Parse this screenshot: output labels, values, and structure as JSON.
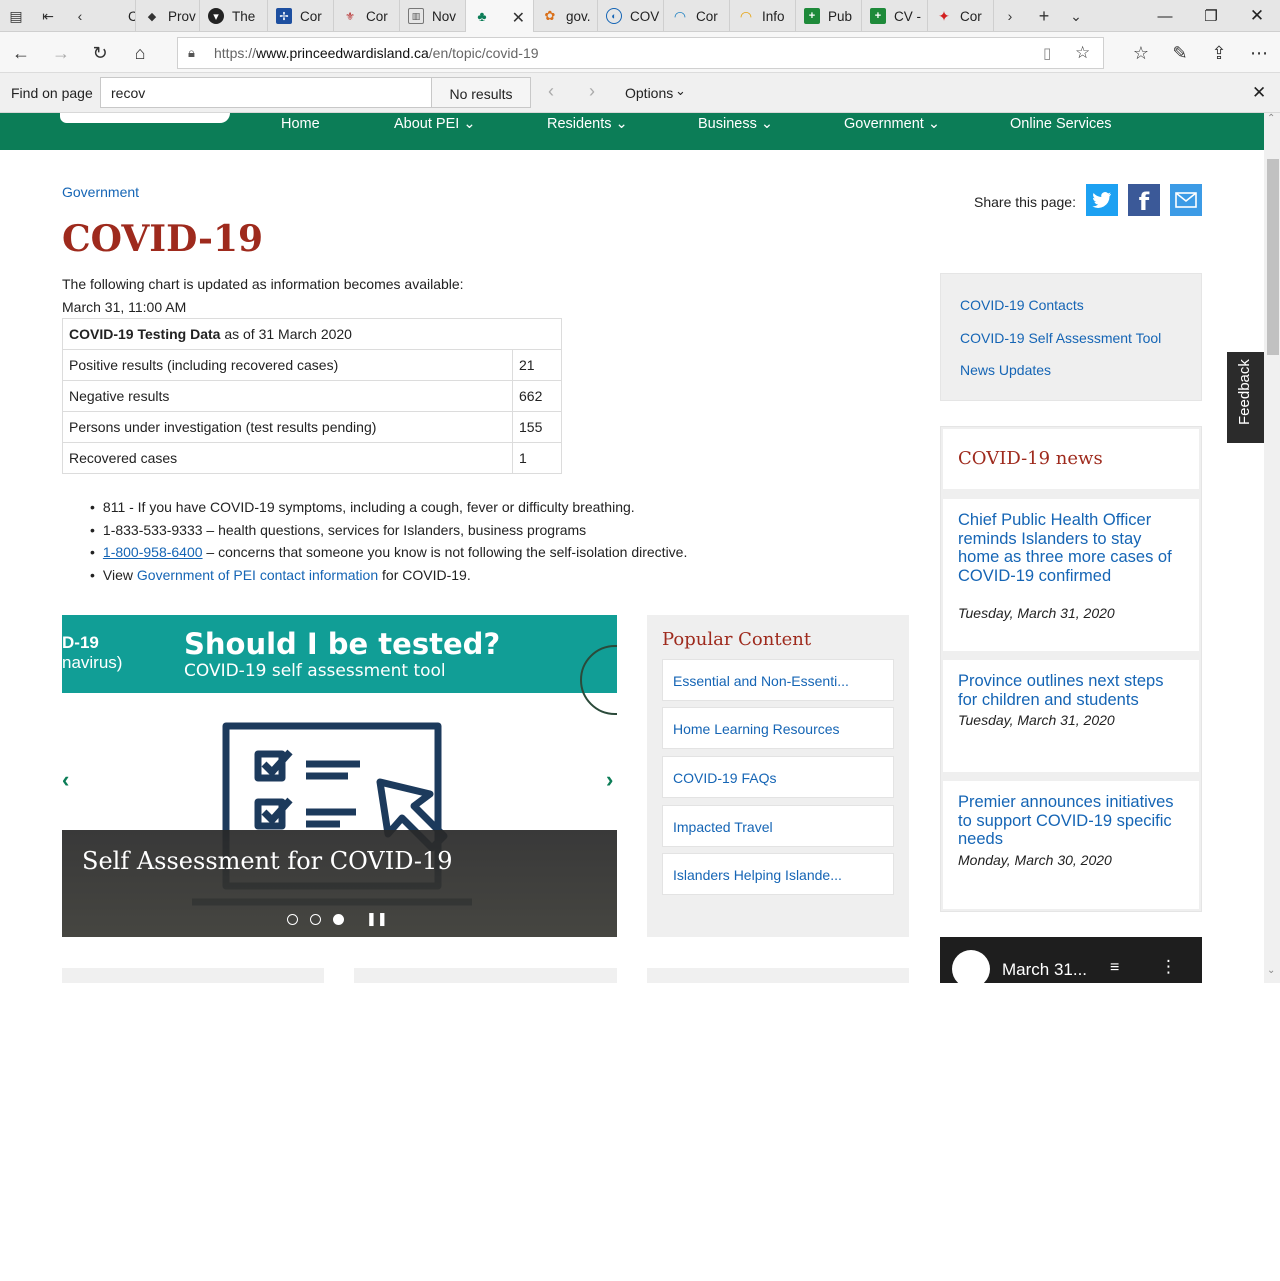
{
  "browser": {
    "tabs": [
      {
        "label": "Case",
        "icon": "page-icon",
        "color": "#555555"
      },
      {
        "label": "Prov",
        "icon": "bison-icon",
        "color": "#333333"
      },
      {
        "label": "The",
        "icon": "shield-icon",
        "color": "#222222"
      },
      {
        "label": "Cor",
        "icon": "fleur-de-lis-icon",
        "color": "#1d4fa0"
      },
      {
        "label": "Cor",
        "icon": "crest-icon",
        "color": "#b32020"
      },
      {
        "label": "Nov",
        "icon": "document-icon",
        "color": "#555555"
      },
      {
        "label": "",
        "icon": "pei-icon",
        "color": "#0c7d57"
      },
      {
        "label": "gov.",
        "icon": "leaves-icon",
        "color": "#d9701a"
      },
      {
        "label": "COV",
        "icon": "globe-icon",
        "color": "#1565b5"
      },
      {
        "label": "Cor",
        "icon": "wave-icon",
        "color": "#1a7fc1"
      },
      {
        "label": "Info",
        "icon": "sun-icon",
        "color": "#e6a20c"
      },
      {
        "label": "Pub",
        "icon": "cross-icon",
        "color": "#1e8a3a"
      },
      {
        "label": "CV -",
        "icon": "cross-icon",
        "color": "#1e8a3a"
      },
      {
        "label": "Cor",
        "icon": "maple-leaf-icon",
        "color": "#d21f1f"
      }
    ],
    "url_prefix": "https://",
    "url_domain": "www.princeedwardisland.ca",
    "url_path": "/en/topic/covid-19",
    "find": {
      "label": "Find on page",
      "query": "recov",
      "results": "No results",
      "options_label": "Options"
    }
  },
  "site": {
    "nav": [
      "Home",
      "About PEI",
      "Residents",
      "Business",
      "Government",
      "Online Services"
    ],
    "breadcrumb": "Government",
    "share_label": "Share this page:",
    "title": "COVID-19",
    "intro": "The following chart is updated as information becomes available:",
    "updated": "March 31, 11:00 AM",
    "table": {
      "heading_bold": "COVID-19 Testing Data",
      "heading_rest": " as of 31 March 2020",
      "rows": [
        {
          "label": "Positive results (including recovered cases)",
          "value": "21"
        },
        {
          "label": "Negative results",
          "value": "662"
        },
        {
          "label": "Persons under investigation (test results pending)",
          "value": "155"
        },
        {
          "label": "Recovered cases",
          "value": "1"
        }
      ]
    },
    "bullets": {
      "b1": "811 - If you have COVID-19 symptoms, including a cough, fever or difficulty breathing.",
      "b2": "1-833-533-9333 – health questions, services for Islanders, business programs",
      "b3_link": "1-800-958-6400",
      "b3_rest": " – concerns that someone you know is not following the self-isolation directive.",
      "b4_pre": "View ",
      "b4_link": "Government of PEI contact information",
      "b4_post": " for COVID-19."
    },
    "carousel": {
      "banner_left_1": "D-19",
      "banner_left_2": "navirus)",
      "banner_title": "Should I be tested?",
      "banner_sub": "COVID-19 self assessment tool",
      "caption": "Self Assessment for COVID-19"
    },
    "popular": {
      "heading": "Popular Content",
      "items": [
        "Essential and Non-Essenti...",
        "Home Learning Resources",
        "COVID-19 FAQs",
        "Impacted Travel",
        "Islanders Helping Islande..."
      ]
    },
    "quicklinks": [
      "COVID-19 Contacts",
      "COVID-19 Self Assessment Tool",
      "News Updates"
    ],
    "news": {
      "heading": "COVID-19 news",
      "items": [
        {
          "title": "Chief Public Health Officer reminds Islanders to stay home as three more cases of COVID-19 confirmed",
          "date": "Tuesday, March 31, 2020"
        },
        {
          "title": "Province outlines next steps for children and students",
          "date": "Tuesday, March 31, 2020"
        },
        {
          "title": "Premier announces initiatives to support COVID-19 specific needs",
          "date": "Monday, March 30, 2020"
        }
      ]
    },
    "video_title": "March 31...",
    "feedback": "Feedback"
  },
  "colors": {
    "header_green": "#0c7d57",
    "title_red": "#9e2a1d",
    "link_blue": "#1565b5",
    "banner_teal": "#119e96",
    "twitter": "#1da1f2",
    "facebook": "#3b5998",
    "email": "#3c9be6"
  }
}
